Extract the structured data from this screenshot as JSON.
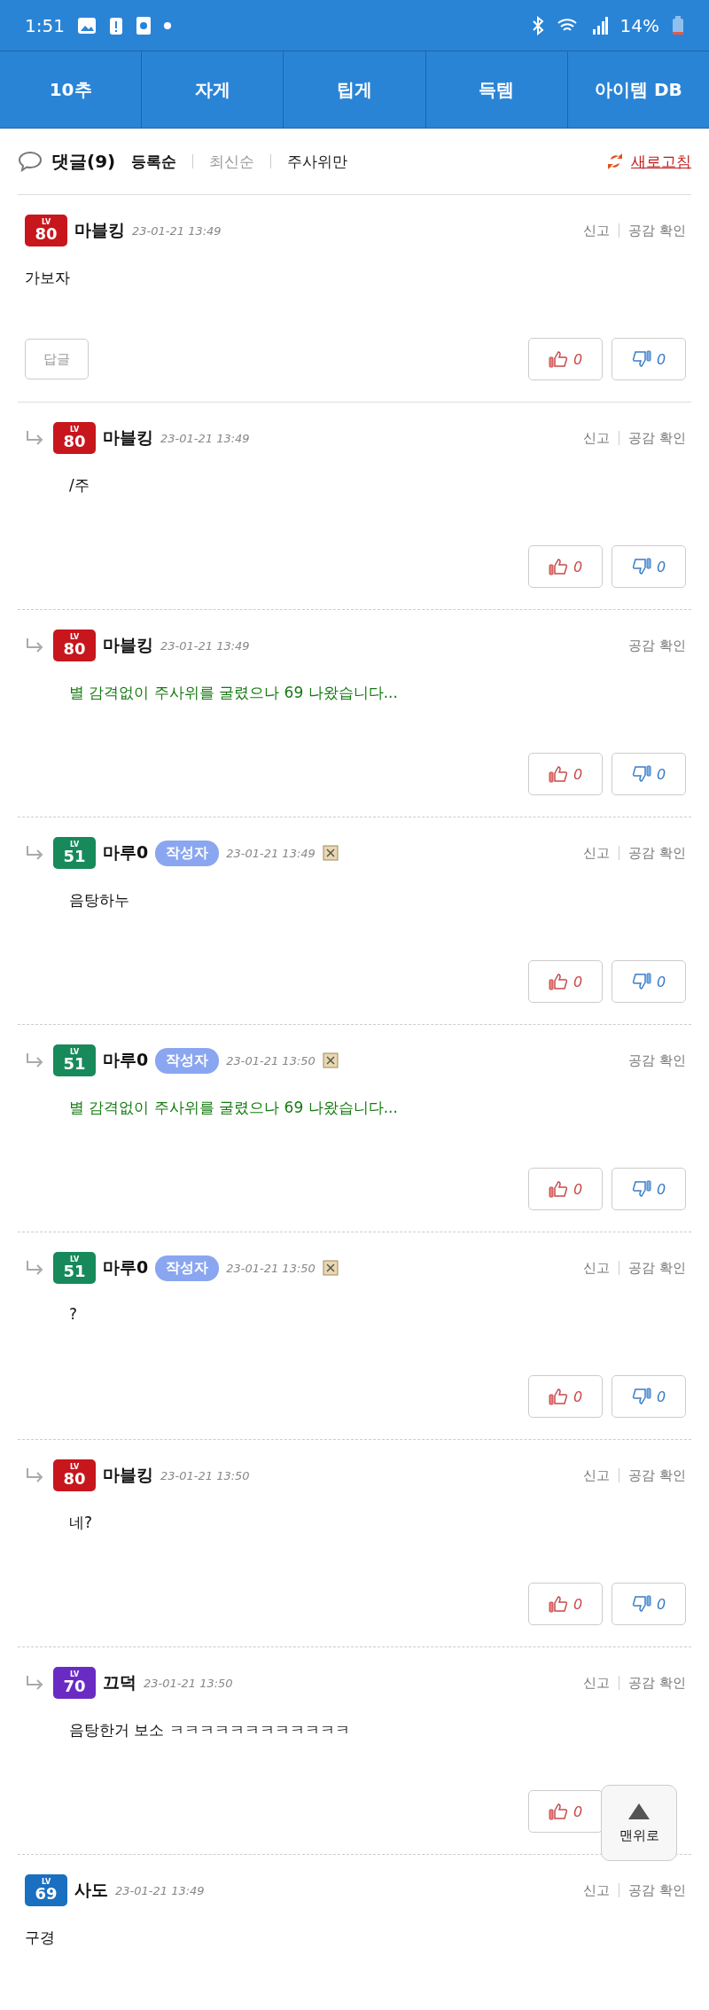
{
  "status_bar": {
    "time": "1:51",
    "battery": "14%"
  },
  "nav_tabs": [
    {
      "label": "10추"
    },
    {
      "label": "자게"
    },
    {
      "label": "팁게"
    },
    {
      "label": "득템"
    },
    {
      "label": "아이템 DB"
    }
  ],
  "comments_header": {
    "title": "댓글(9)",
    "sort_options": [
      {
        "label": "등록순",
        "selected": true,
        "color": "#111111"
      },
      {
        "label": "최신순",
        "selected": false,
        "color": "#999999"
      },
      {
        "label": "주사위만",
        "selected": false,
        "color": "#222222"
      }
    ],
    "refresh": "새로고침"
  },
  "comments": [
    {
      "reply": false,
      "level_label": "LV",
      "level": "80",
      "color": "#c8161d",
      "name": "마블킹",
      "date": "23-01-21 13:49",
      "image_icon": false,
      "report": "신고",
      "likes_check": "공감 확인",
      "body": "가보자",
      "kind": "normal",
      "reply_button": "답글",
      "likes": "0",
      "dislikes": "0"
    },
    {
      "reply": true,
      "level_label": "LV",
      "level": "80",
      "color": "#c8161d",
      "name": "마블킹",
      "date": "23-01-21 13:49",
      "image_icon": false,
      "report": "신고",
      "likes_check": "공감 확인",
      "body": "/주",
      "kind": "normal",
      "likes": "0",
      "dislikes": "0"
    },
    {
      "reply": true,
      "level_label": "LV",
      "level": "80",
      "color": "#c8161d",
      "name": "마블킹",
      "date": "23-01-21 13:49",
      "image_icon": false,
      "likes_check": "공감 확인",
      "body": "별 감격없이 주사위를 굴렸으나 69 나왔습니다...",
      "kind": "dice",
      "likes": "0",
      "dislikes": "0"
    },
    {
      "reply": true,
      "level_label": "LV",
      "level": "51",
      "color": "#17895a",
      "name": "마루0",
      "author_badge": "작성자",
      "date": "23-01-21 13:49",
      "image_icon": true,
      "report": "신고",
      "likes_check": "공감 확인",
      "body": "음탕하누",
      "kind": "normal",
      "likes": "0",
      "dislikes": "0"
    },
    {
      "reply": true,
      "level_label": "LV",
      "level": "51",
      "color": "#17895a",
      "name": "마루0",
      "author_badge": "작성자",
      "date": "23-01-21 13:50",
      "image_icon": true,
      "likes_check": "공감 확인",
      "body": "별 감격없이 주사위를 굴렸으나 69 나왔습니다...",
      "kind": "dice",
      "likes": "0",
      "dislikes": "0"
    },
    {
      "reply": true,
      "level_label": "LV",
      "level": "51",
      "color": "#17895a",
      "name": "마루0",
      "author_badge": "작성자",
      "date": "23-01-21 13:50",
      "image_icon": true,
      "report": "신고",
      "likes_check": "공감 확인",
      "body": "?",
      "kind": "normal",
      "likes": "0",
      "dislikes": "0"
    },
    {
      "reply": true,
      "level_label": "LV",
      "level": "80",
      "color": "#c8161d",
      "name": "마블킹",
      "date": "23-01-21 13:50",
      "image_icon": false,
      "report": "신고",
      "likes_check": "공감 확인",
      "body": "네?",
      "kind": "normal",
      "likes": "0",
      "dislikes": "0"
    },
    {
      "reply": true,
      "level_label": "LV",
      "level": "70",
      "color": "#6a2bc4",
      "name": "끄덕",
      "date": "23-01-21 13:50",
      "image_icon": false,
      "report": "신고",
      "likes_check": "공감 확인",
      "body": "음탕한거 보소 ㅋㅋㅋㅋㅋㅋㅋㅋㅋㅋㅋㅋ",
      "kind": "normal",
      "likes": "0"
    },
    {
      "reply": false,
      "level_label": "LV",
      "level": "69",
      "color": "#1a6fc0",
      "name": "사도",
      "date": "23-01-21 13:49",
      "image_icon": false,
      "report": "신고",
      "likes_check": "공감 확인",
      "body": "구경",
      "kind": "normal"
    }
  ],
  "scroll_top_button": "맨위로"
}
